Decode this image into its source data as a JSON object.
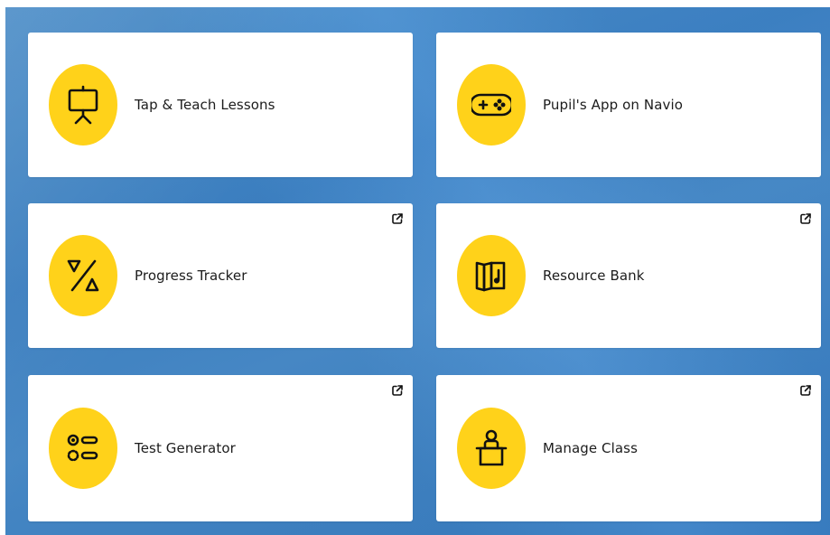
{
  "tiles": [
    {
      "label": "Tap & Teach Lessons",
      "icon": "presentation-board-icon",
      "external": false
    },
    {
      "label": "Pupil's App on Navio",
      "icon": "gamepad-icon",
      "external": false
    },
    {
      "label": "Progress Tracker",
      "icon": "triangles-icon",
      "external": true
    },
    {
      "label": "Resource Bank",
      "icon": "folded-pages-icon",
      "external": true
    },
    {
      "label": "Test Generator",
      "icon": "options-list-icon",
      "external": true
    },
    {
      "label": "Manage Class",
      "icon": "teacher-desk-icon",
      "external": true
    }
  ],
  "colors": {
    "background": "#4389cd",
    "card": "#ffffff",
    "badge": "#ffd21a",
    "text": "#1c1c1c"
  }
}
